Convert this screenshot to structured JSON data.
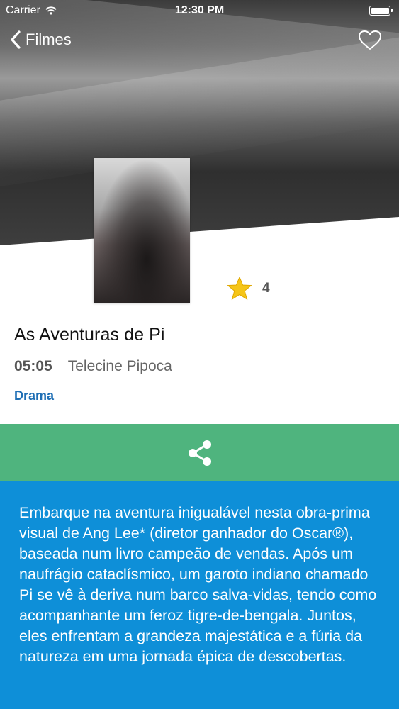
{
  "status_bar": {
    "carrier": "Carrier",
    "time": "12:30 PM"
  },
  "nav": {
    "back_label": "Filmes",
    "back_icon": "chevron-left-icon",
    "favorite_icon": "heart-outline-icon"
  },
  "movie": {
    "title": "As Aventuras de Pi",
    "time": "05:05",
    "channel": "Telecine Pipoca",
    "genre": "Drama",
    "rating": "4",
    "rating_icon": "star-icon"
  },
  "share": {
    "icon": "share-icon"
  },
  "synopsis": {
    "text": "Embarque na aventura inigualável nesta obra-prima visual de Ang Lee* (diretor ganhador do Oscar®), baseada num livro campeão de vendas. Após um naufrágio cataclísmico, um garoto indiano chamado Pi se vê à deriva num barco salva-vidas, tendo como acompanhante um feroz tigre-de-bengala. Juntos, eles enfrentam a grandeza majestática e a fúria da natureza em uma jornada épica de descobertas."
  },
  "colors": {
    "share_bar": "#4fb47e",
    "synopsis_bg": "#0e8fd8",
    "genre": "#1f6fb5",
    "star": "#f5c518"
  }
}
